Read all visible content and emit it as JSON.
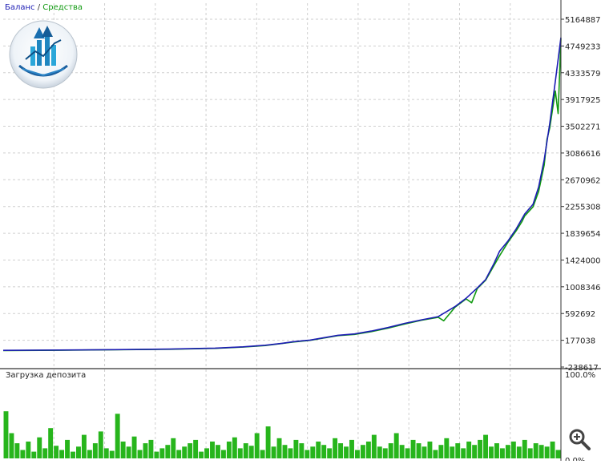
{
  "legend": {
    "balance_label": "Баланс",
    "separator": "/",
    "equity_label": "Средства",
    "balance_color": "#1c1cb4",
    "equity_color": "#119a11"
  },
  "icons": {
    "logo": "trading-logo-icon",
    "zoom": "zoom-in-icon"
  },
  "chart_data": [
    {
      "type": "line",
      "title": "",
      "legend_position": "top-left",
      "grid": true,
      "y_ticks": [
        5164887,
        4749233,
        4333579,
        3917925,
        3502271,
        3086616,
        2670962,
        2255308,
        1839654,
        1424000,
        1008346,
        592692,
        177038,
        -238617
      ],
      "y_tick_labels": [
        "5164887",
        "4749233",
        "4333579",
        "3917925",
        "3502271",
        "3086616",
        "2670962",
        "2255308",
        "1839654",
        "1424000",
        "1008346",
        "592692",
        "177038",
        "-238617"
      ],
      "ylim": [
        -238617,
        5164887
      ],
      "xlim": [
        0,
        100
      ],
      "series": [
        {
          "name": "Баланс",
          "color": "#1c1cb4",
          "x": [
            0,
            10,
            20,
            30,
            38,
            43,
            47,
            50,
            52,
            55,
            58,
            60,
            63,
            66,
            69,
            72,
            75,
            78,
            81,
            83,
            85,
            86.5,
            88,
            89,
            90.5,
            92,
            93.5,
            95,
            96,
            97,
            98,
            99,
            100
          ],
          "y": [
            20000,
            25000,
            32000,
            40000,
            55000,
            75000,
            100000,
            130000,
            155000,
            180000,
            225000,
            255000,
            275000,
            320000,
            375000,
            440000,
            495000,
            545000,
            700000,
            830000,
            990000,
            1120000,
            1370000,
            1560000,
            1720000,
            1910000,
            2140000,
            2290000,
            2560000,
            2980000,
            3550000,
            4200000,
            4880000
          ]
        },
        {
          "name": "Средства",
          "color": "#119a11",
          "x": [
            0,
            10,
            20,
            30,
            38,
            43,
            47,
            50,
            52,
            55,
            58,
            60,
            63,
            66,
            69,
            72,
            75,
            78,
            79,
            81,
            83,
            84,
            85,
            86.5,
            88,
            89,
            90.5,
            92,
            93,
            93.5,
            95,
            96,
            97,
            97.5,
            98,
            99,
            99.5,
            100
          ],
          "y": [
            18000,
            22000,
            30000,
            38000,
            52000,
            72000,
            95000,
            128000,
            150000,
            176000,
            220000,
            250000,
            268000,
            312000,
            365000,
            430000,
            488000,
            535000,
            480000,
            690000,
            820000,
            760000,
            980000,
            1110000,
            1340000,
            1490000,
            1700000,
            1880000,
            2020000,
            2110000,
            2250000,
            2490000,
            2900000,
            3300000,
            3480000,
            4050000,
            3700000,
            4860000
          ]
        }
      ]
    },
    {
      "type": "bar",
      "title": "Загрузка депозита",
      "y_tick_labels": [
        "100.0%",
        "0.0%"
      ],
      "ylim": [
        0,
        100
      ],
      "xlim": [
        0,
        100
      ],
      "x": [
        0,
        1,
        2,
        3,
        4,
        5,
        6,
        7,
        8,
        9,
        10,
        11,
        12,
        13,
        14,
        15,
        16,
        17,
        18,
        19,
        20,
        21,
        22,
        23,
        24,
        25,
        26,
        27,
        28,
        29,
        30,
        31,
        32,
        33,
        34,
        35,
        36,
        37,
        38,
        39,
        40,
        41,
        42,
        43,
        44,
        45,
        46,
        47,
        48,
        49,
        50,
        51,
        52,
        53,
        54,
        55,
        56,
        57,
        58,
        59,
        60,
        61,
        62,
        63,
        64,
        65,
        66,
        67,
        68,
        69,
        70,
        71,
        72,
        73,
        74,
        75,
        76,
        77,
        78,
        79,
        80,
        81,
        82,
        83,
        84,
        85,
        86,
        87,
        88,
        89,
        90,
        91,
        92,
        93,
        94,
        95,
        96,
        97,
        98,
        99
      ],
      "values": [
        56,
        30,
        18,
        10,
        20,
        8,
        25,
        12,
        36,
        15,
        10,
        22,
        8,
        14,
        28,
        10,
        18,
        32,
        12,
        9,
        53,
        20,
        14,
        26,
        10,
        18,
        22,
        8,
        12,
        16,
        24,
        10,
        14,
        18,
        22,
        8,
        12,
        20,
        16,
        10,
        20,
        25,
        12,
        18,
        15,
        30,
        10,
        38,
        14,
        24,
        16,
        12,
        22,
        18,
        10,
        14,
        20,
        16,
        12,
        24,
        18,
        14,
        22,
        10,
        16,
        20,
        28,
        14,
        12,
        18,
        30,
        16,
        12,
        22,
        18,
        14,
        20,
        10,
        16,
        24,
        14,
        18,
        12,
        20,
        16,
        22,
        28,
        14,
        18,
        12,
        16,
        20,
        14,
        22,
        12,
        18,
        16,
        14,
        20,
        10
      ]
    }
  ]
}
